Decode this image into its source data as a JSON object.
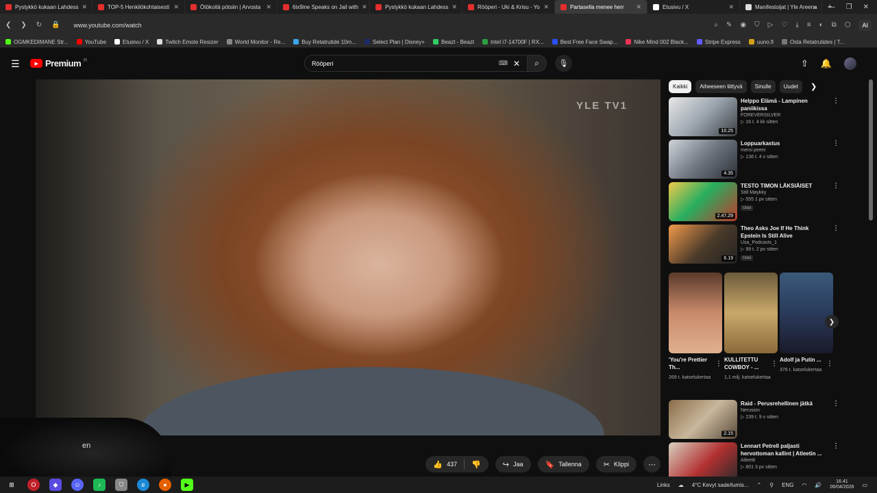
{
  "browser": {
    "tabs": [
      {
        "label": "Pystykkö kukaan Lahdess",
        "fav": "#e52e2e"
      },
      {
        "label": "TOP-5 Henkilökohtaisesti",
        "fav": "#e52e2e"
      },
      {
        "label": "Ötökoitä pötsiin | Arvosta",
        "fav": "#e52e2e"
      },
      {
        "label": "6ix9ine Speaks on Jail with",
        "fav": "#e52e2e"
      },
      {
        "label": "Pystykkö kukaan Lahdess",
        "fav": "#e52e2e"
      },
      {
        "label": "Rööperi - Uki & Krisu - Yo",
        "fav": "#e52e2e"
      },
      {
        "label": "Partasella menee herr",
        "fav": "#e52e2e",
        "active": true
      },
      {
        "label": "Etusivu / X",
        "fav": "#ffffff"
      },
      {
        "label": "Manifestoijat | Yle Areena",
        "fav": "#dddddd"
      }
    ],
    "url": "www.youtube.com/watch",
    "ai_label": "AI",
    "bookmarks": [
      {
        "label": "OGMKEDIMANE Str...",
        "fav": "#53fc18"
      },
      {
        "label": "YouTube",
        "fav": "#ff0000"
      },
      {
        "label": "Etusivu / X",
        "fav": "#ffffff"
      },
      {
        "label": "Twitch Emote Resizer",
        "fav": "#dddddd"
      },
      {
        "label": "World Monitor - Re...",
        "fav": "#888888"
      },
      {
        "label": "Buy Retatrutide 10m...",
        "fav": "#3aa6e8"
      },
      {
        "label": "Select Plan | Disney+",
        "fav": "#1b2a6b"
      },
      {
        "label": "Beazt - Beazt",
        "fav": "#33cc66"
      },
      {
        "label": "Intel i7-14700F | RX...",
        "fav": "#2ea043"
      },
      {
        "label": "Best Free Face Swap...",
        "fav": "#2b4fff"
      },
      {
        "label": "Nike Mind 002 Black...",
        "fav": "#ee3355"
      },
      {
        "label": "Stripe Express",
        "fav": "#635bff"
      },
      {
        "label": "uuno.fi",
        "fav": "#d4a017"
      },
      {
        "label": "Osta Retatrutides | T...",
        "fav": "#777777"
      }
    ]
  },
  "youtube": {
    "logo": "Premium",
    "logo_sup": "FI",
    "search_value": "Rööperi",
    "watermark": "YLE TV1",
    "webcam_text": "en",
    "actions": {
      "likes": "437",
      "share": "Jaa",
      "save": "Tallenna",
      "clip": "Klippi"
    },
    "chips": [
      "Kaikki",
      "Aiheeseen liittyvä",
      "Sinulle",
      "Uudet"
    ],
    "recommendations": [
      {
        "title": "Helppo Elämä - Lampinen paniikissa",
        "channel": "FOREVERSILVER",
        "stats": "▷ 16 t.   4 kk sitten",
        "duration": "10.25",
        "badge": ""
      },
      {
        "title": "Loppuarkastus",
        "channel": "mersi peeni",
        "stats": "▷ 136 t.   4 v sitten",
        "duration": "4.35",
        "badge": ""
      },
      {
        "title": "TESTO TIMON LÄKSIÄISET",
        "channel": "Still Møykky",
        "stats": "▷ 555   1 pv sitten",
        "duration": "2.47.29",
        "badge": "Uusi"
      },
      {
        "title": "Theo Asks Joe If He Think Epstein Is Still Alive",
        "channel": "Usa_Podcasts_1",
        "stats": "▷ 99 t.   2 pv sitten",
        "duration": "6.19",
        "badge": "Uusi"
      }
    ],
    "shorts": [
      {
        "title": "'You're Prettier Th...",
        "views": "269 t. katselukertaa"
      },
      {
        "title": "KULLITETTU COWBOY - ...",
        "views": "1,1 milj. katselukertaa"
      },
      {
        "title": "Adolf ja Putin ...",
        "views": "376 t. katselukertaa"
      }
    ],
    "more_recommendations": [
      {
        "title": "Raid - Perusrehellinen jätkä",
        "channel": "Nerusion",
        "stats": "▷ 239 t.   9 v sitten",
        "duration": "2.15",
        "badge": ""
      },
      {
        "title": "Lennart Petrell paljasti hervottoman kallint | Atleetin ...",
        "channel": "Atleetti",
        "stats": "▷ 801   3 pv sitten",
        "duration": "",
        "badge": ""
      }
    ]
  },
  "taskbar": {
    "links": "Links",
    "weather": "4°C  Kevyt sade/lumis...",
    "lang": "ENG",
    "time": "16.41",
    "date": "06/04/2026"
  }
}
